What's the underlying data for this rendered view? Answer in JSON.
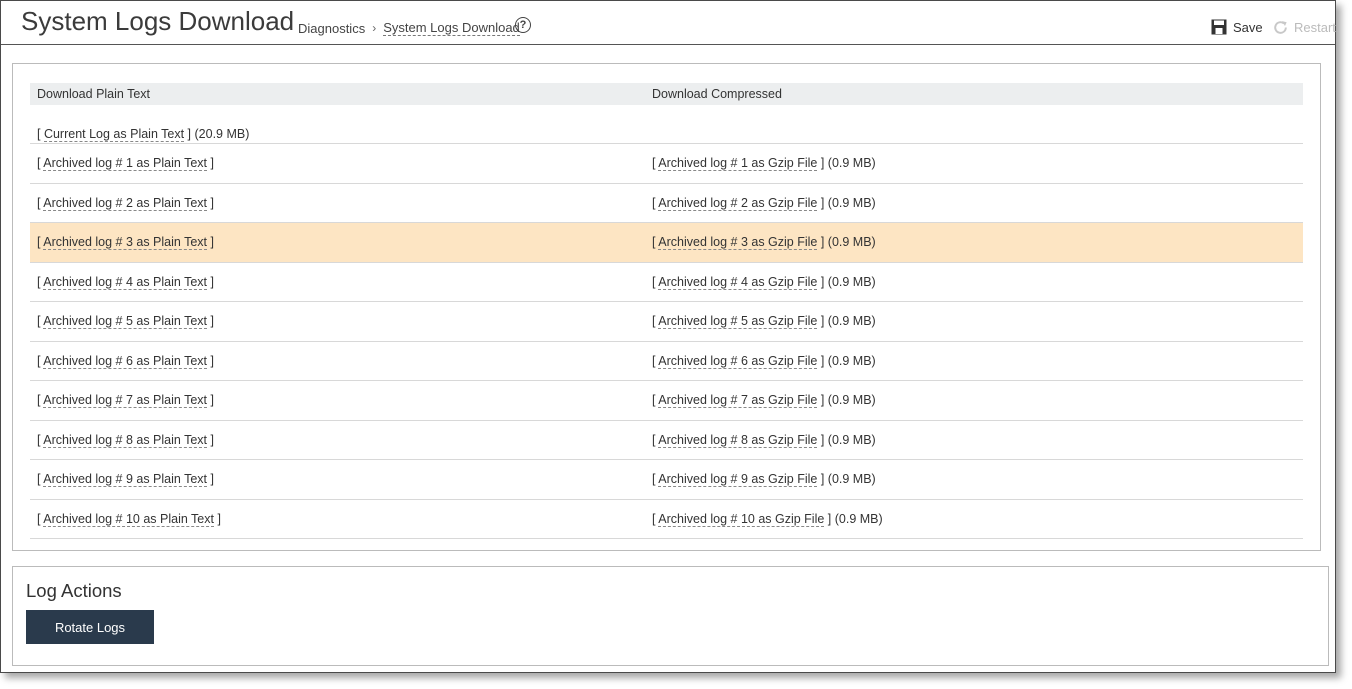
{
  "header": {
    "title": "System Logs Download",
    "breadcrumb": [
      "Diagnostics",
      "System Logs Download"
    ],
    "help_glyph": "?",
    "save_label": "Save",
    "restart_label": "Restart"
  },
  "table": {
    "col_plain": "Download Plain Text",
    "col_compressed": "Download Compressed",
    "rows": [
      {
        "plain_link": "Current Log as Plain Text",
        "plain_size": "(20.9 MB)",
        "gzip_link": "",
        "gzip_size": "",
        "highlighted": false
      },
      {
        "plain_link": "Archived log # 1 as Plain Text",
        "plain_size": "",
        "gzip_link": "Archived log # 1 as Gzip File",
        "gzip_size": "(0.9 MB)",
        "highlighted": false
      },
      {
        "plain_link": "Archived log # 2 as Plain Text",
        "plain_size": "",
        "gzip_link": "Archived log # 2 as Gzip File",
        "gzip_size": "(0.9 MB)",
        "highlighted": false
      },
      {
        "plain_link": "Archived log # 3 as Plain Text",
        "plain_size": "",
        "gzip_link": "Archived log # 3 as Gzip File",
        "gzip_size": "(0.9 MB)",
        "highlighted": true
      },
      {
        "plain_link": "Archived log # 4 as Plain Text",
        "plain_size": "",
        "gzip_link": "Archived log # 4 as Gzip File",
        "gzip_size": "(0.9 MB)",
        "highlighted": false
      },
      {
        "plain_link": "Archived log # 5 as Plain Text",
        "plain_size": "",
        "gzip_link": "Archived log # 5 as Gzip File",
        "gzip_size": "(0.9 MB)",
        "highlighted": false
      },
      {
        "plain_link": "Archived log # 6 as Plain Text",
        "plain_size": "",
        "gzip_link": "Archived log # 6 as Gzip File",
        "gzip_size": "(0.9 MB)",
        "highlighted": false
      },
      {
        "plain_link": "Archived log # 7 as Plain Text",
        "plain_size": "",
        "gzip_link": "Archived log # 7 as Gzip File",
        "gzip_size": "(0.9 MB)",
        "highlighted": false
      },
      {
        "plain_link": "Archived log # 8 as Plain Text",
        "plain_size": "",
        "gzip_link": "Archived log # 8 as Gzip File",
        "gzip_size": "(0.9 MB)",
        "highlighted": false
      },
      {
        "plain_link": "Archived log # 9 as Plain Text",
        "plain_size": "",
        "gzip_link": "Archived log # 9 as Gzip File",
        "gzip_size": "(0.9 MB)",
        "highlighted": false
      },
      {
        "plain_link": "Archived log # 10 as Plain Text",
        "plain_size": "",
        "gzip_link": "Archived log # 10 as Gzip File",
        "gzip_size": "(0.9 MB)",
        "highlighted": false
      }
    ]
  },
  "log_actions": {
    "title": "Log Actions",
    "rotate_label": "Rotate Logs"
  },
  "icons": {
    "save": "save-icon",
    "restart": "restart-icon",
    "help": "help-icon"
  },
  "colors": {
    "highlight_row": "#fde5c3",
    "button_bg": "#2a3a4c",
    "table_header_bg": "#eceeef"
  }
}
